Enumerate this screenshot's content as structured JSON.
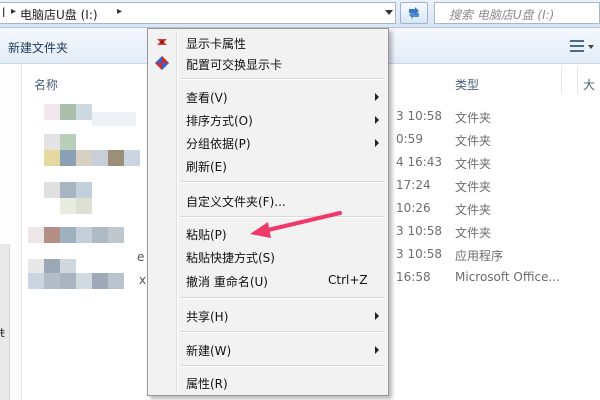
{
  "address_bar": {
    "left_fragment": "l",
    "path": "电脑店U盘 (I:)",
    "search_placeholder": "搜索 电脑店U盘 (I:)"
  },
  "toolbar": {
    "new_folder": "新建文件夹"
  },
  "nav_pane": {
    "fragment": "ŧ"
  },
  "columns": {
    "name": "名称",
    "type": "类型",
    "size": "大"
  },
  "rows": [
    {
      "date": "3 10:58",
      "type": "文件夹"
    },
    {
      "date": "0:59",
      "type": "文件夹"
    },
    {
      "date": "4 16:43",
      "type": "文件夹"
    },
    {
      "date": "17:24",
      "type": "文件夹"
    },
    {
      "date": "10:26",
      "type": "文件夹"
    },
    {
      "date": "3 10:58",
      "type": "文件夹"
    },
    {
      "date": "3 10:58",
      "type": "应用程序"
    },
    {
      "date": "16:58",
      "type": "Microsoft Office..."
    }
  ],
  "row_name_fragments": {
    "row7": "e",
    "row8": "x"
  },
  "context_menu": {
    "items": [
      {
        "label": "显示卡属性",
        "icon": "display-card-icon"
      },
      {
        "label": "配置可交换显示卡",
        "icon": "switchable-graphics-icon"
      },
      {
        "label": "查看(V)",
        "submenu": true
      },
      {
        "label": "排序方式(O)",
        "submenu": true
      },
      {
        "label": "分组依据(P)",
        "submenu": true
      },
      {
        "label": "刷新(E)"
      },
      {
        "label": "自定义文件夹(F)..."
      },
      {
        "label": "粘贴(P)"
      },
      {
        "label": "粘贴快捷方式(S)"
      },
      {
        "label": "撤消 重命名(U)",
        "shortcut": "Ctrl+Z"
      },
      {
        "label": "共享(H)",
        "submenu": true
      },
      {
        "label": "新建(W)",
        "submenu": true
      },
      {
        "label": "属性(R)"
      }
    ]
  },
  "colors": {
    "annotation_arrow": "#f0386b",
    "menu_bg": "#f2f2f2",
    "toolbar_text": "#1e395b"
  }
}
